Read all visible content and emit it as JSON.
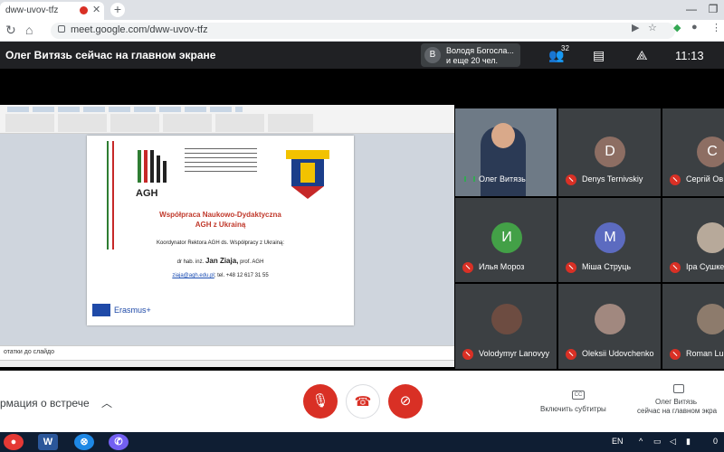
{
  "browser": {
    "tab_title": "dww-uvov-tfz",
    "url": "meet.google.com/dww-uvov-tfz"
  },
  "meet": {
    "presenting_title": "Олег Витязь сейчас на главном экране",
    "people_chip": {
      "avatar_letter": "В",
      "line1": "Володя Богосла...",
      "line2": "и еще 20 чел."
    },
    "participant_count": "32",
    "time": "11:13"
  },
  "slide": {
    "agh_label": "AGH",
    "title_line1": "Współpraca Naukowo-Dydaktyczna",
    "title_line2": "AGH z Ukrainą",
    "coordinator": "Koordynator Rektora AGH ds. Współpracy z Ukrainą:",
    "name_prefix": "dr hab. inż.",
    "name": "Jan Ziaja,",
    "name_suffix": "prof. AGH",
    "email": "ziaja@agh.edu.pl",
    "phone": "; tel. +48 12 617 31 55",
    "erasmus": "Erasmus+",
    "notes_text": "отатки до слайдо"
  },
  "participants": [
    {
      "name": "Олег Витязь",
      "type": "video",
      "mic": "on"
    },
    {
      "name": "Denys Ternivskiy",
      "letter": "D",
      "color": "#8d6e63",
      "mic": "muted"
    },
    {
      "name": "Сергій Ов",
      "letter": "С",
      "color": "#8d6e63",
      "mic": "muted"
    },
    {
      "name": "Илья Мороз",
      "letter": "И",
      "color": "#43a047",
      "mic": "muted"
    },
    {
      "name": "Міша Струць",
      "letter": "М",
      "color": "#5c6bc0",
      "mic": "muted"
    },
    {
      "name": "Іра Сушке",
      "type": "photo",
      "mic": "muted"
    },
    {
      "name": "Volodymyr Lanovyy",
      "type": "photo",
      "mic": "muted"
    },
    {
      "name": "Oleksii Udovchenko",
      "type": "photo",
      "mic": "muted"
    },
    {
      "name": "Roman Lu",
      "type": "photo",
      "mic": "muted"
    }
  ],
  "bottombar": {
    "meeting_info": "рмация о встрече",
    "subtitles_label": "Включить субтитры",
    "presenter_line1": "Олег Витязь",
    "presenter_line2": "сейчас на главном экра"
  },
  "taskbar": {
    "lang": "EN",
    "time_fragment": "0"
  }
}
